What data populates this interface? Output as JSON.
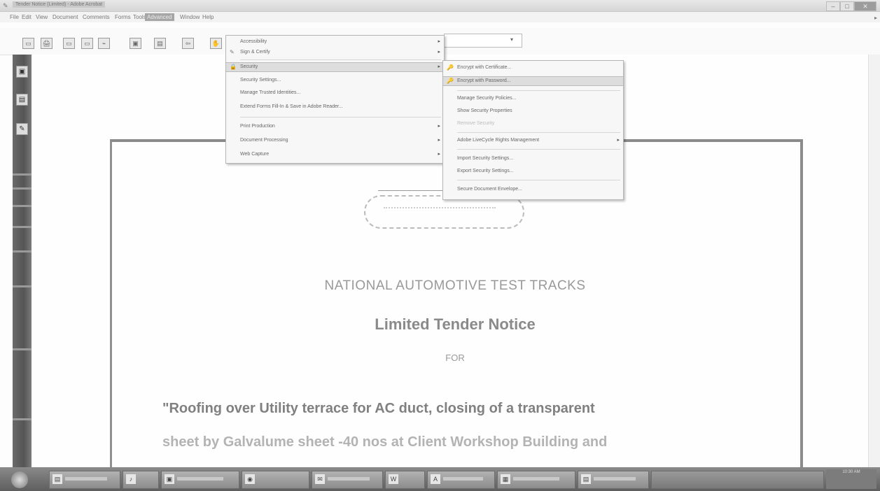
{
  "window": {
    "title": "Tender Notice (Limited) - Adobe Acrobat",
    "controls": [
      "–",
      "□",
      "✕"
    ]
  },
  "menubar": {
    "items": [
      "File",
      "Edit",
      "View",
      "Document",
      "Comments",
      "Forms",
      "Tools",
      "Advanced",
      "Window",
      "Help"
    ],
    "active": "Advanced",
    "arrow": "▸"
  },
  "toolbar": {
    "icons": [
      "▭",
      "🖨",
      "▭",
      "▭",
      "⌁",
      "▣",
      "▤",
      "⇦",
      "✋"
    ],
    "zoom_combo_value": "",
    "combo_arrow": "▾"
  },
  "advanced_menu": {
    "items": [
      {
        "label": "Accessibility",
        "submenu": true,
        "icon": ""
      },
      {
        "label": "Sign & Certify",
        "submenu": true,
        "icon": "✎"
      },
      {
        "label": "Security",
        "submenu": true,
        "icon": "🔒",
        "highlighted": true
      },
      {
        "label": "Security Settings...",
        "submenu": false,
        "icon": ""
      },
      {
        "label": "Manage Trusted Identities...",
        "submenu": false,
        "icon": ""
      },
      {
        "label": "Extend Forms Fill-In & Save in Adobe Reader...",
        "submenu": false,
        "icon": ""
      },
      {
        "label": "Print Production",
        "submenu": true,
        "icon": ""
      },
      {
        "label": "Document Processing",
        "submenu": true,
        "icon": ""
      },
      {
        "label": "Web Capture",
        "submenu": true,
        "icon": ""
      }
    ]
  },
  "security_submenu": {
    "items": [
      {
        "label": "Encrypt with Certificate...",
        "icon": "🔑",
        "disabled": false,
        "submenu": false
      },
      {
        "label": "Encrypt with Password...",
        "icon": "🔑",
        "disabled": false,
        "submenu": false,
        "highlighted": true
      },
      {
        "label": "Manage Security Policies...",
        "icon": "",
        "disabled": false,
        "submenu": false
      },
      {
        "label": "Show Security Properties",
        "icon": "",
        "disabled": false,
        "submenu": false
      },
      {
        "label": "Remove Security",
        "icon": "",
        "disabled": true,
        "submenu": false
      },
      {
        "label": "Adobe LiveCycle Rights Management",
        "icon": "",
        "disabled": false,
        "submenu": true
      },
      {
        "label": "Import Security Settings...",
        "icon": "",
        "disabled": false,
        "submenu": false
      },
      {
        "label": "Export Security Settings...",
        "icon": "",
        "disabled": false,
        "submenu": false
      },
      {
        "label": "Secure Document Envelope...",
        "icon": "",
        "disabled": false,
        "submenu": false
      }
    ]
  },
  "leftnav": {
    "icons": [
      "▣",
      "▤",
      "✎"
    ]
  },
  "document": {
    "org": "NATIONAL AUTOMOTIVE TEST TRACKS",
    "heading": "Limited Tender Notice",
    "for": "FOR",
    "body_line1": "\"Roofing over Utility terrace for AC duct, closing of a transparent",
    "body_line2": "sheet by Galvalume sheet -40 nos at Client Workshop Building and"
  },
  "taskbar": {
    "tray_time": "10:30 AM"
  }
}
